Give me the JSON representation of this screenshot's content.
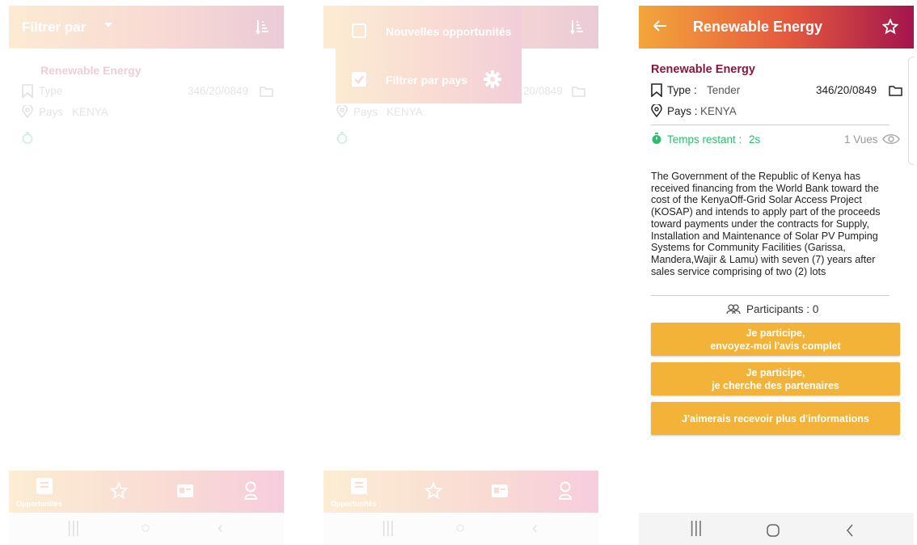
{
  "panel1": {
    "appbar_title": "Filtrer par",
    "item_title": "Renewable Energy",
    "type_label": "Type",
    "reference": "346/20/0849",
    "country_label": "Pays",
    "country_value": "KENYA",
    "nav_label": "Opportunités"
  },
  "panel2": {
    "menu_new": "Nouvelles opportunités",
    "menu_filter_country": "Filtrer par pays",
    "ref_partial": "20/0849",
    "country_label": "Pays",
    "country_value": "KENYA",
    "nav_label": "Opportunités"
  },
  "detail": {
    "appbar_title": "Renewable Energy",
    "title": "Renewable Energy",
    "type_label": "Type",
    "type_value": "Tender",
    "reference": "346/20/0849",
    "country_label": "Pays",
    "country_value": "KENYA",
    "time_left_label": "Temps restant",
    "time_left_value": "2s",
    "views": "1 Vues",
    "description": "The Government of the Republic of Kenya has received financing from the World Bank toward the cost of the KenyaOff-Grid Solar Access Project (KOSAP) and intends to apply part of the proceeds toward payments under the contracts for Supply, Installation and Maintenance of Solar PV Pumping Systems for Community Facilities (Garissa, Mandera,Wajir & Lamu) with seven (7) years after sales service comprising of two (2) lots",
    "participants_label": "Participants",
    "participants_count": "0",
    "btn1_line1": "Je participe,",
    "btn1_line2": "envoyez-moi l'avis complet",
    "btn2_line1": "Je participe,",
    "btn2_line2": "je cherche des partenaires",
    "btn3": "J'aimerais recevoir plus d'informations"
  },
  "colors": {
    "accent_orange": "#f3b238",
    "title_maroon": "#8c1540",
    "timer_green": "#2bbd6b"
  },
  "icons": [
    "back-arrow-icon",
    "star-icon",
    "bookmark-icon",
    "folder-icon",
    "location-pin-icon",
    "timer-icon",
    "eye-icon",
    "participants-icon",
    "sort-icon",
    "dropdown-arrow-icon",
    "gear-icon",
    "checkbox-icon",
    "opportunities-icon",
    "id-card-icon",
    "profile-icon"
  ]
}
